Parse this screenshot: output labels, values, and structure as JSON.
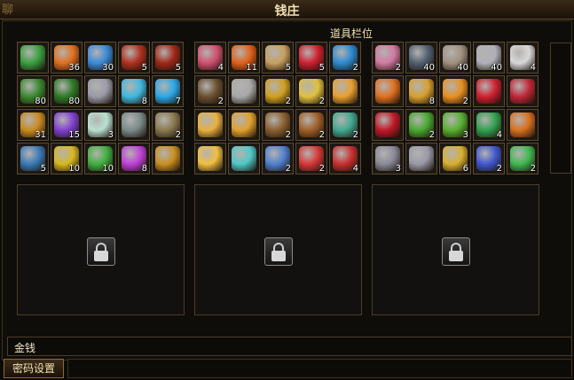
{
  "window": {
    "title": "钱庄",
    "title_deco": "聊"
  },
  "bag": {
    "label": "道具栏位"
  },
  "gold": {
    "label": "金钱"
  },
  "password_button": {
    "label": "密码设置"
  },
  "panels": [
    {
      "items": [
        {
          "icon": "green-leaf-icon",
          "color": "#3aa040",
          "count": ""
        },
        {
          "icon": "flame-icon",
          "color": "#e07020",
          "count": "36"
        },
        {
          "icon": "blue-crystal-icon",
          "color": "#3a8ad8",
          "count": "30"
        },
        {
          "icon": "red-beetle-icon",
          "color": "#b03020",
          "count": "5"
        },
        {
          "icon": "red-beetle-icon",
          "color": "#a02818",
          "count": "5"
        },
        {
          "icon": "green-leaf-icon",
          "color": "#3a8a30",
          "count": "80"
        },
        {
          "icon": "green-leaf-icon",
          "color": "#2e7a28",
          "count": "80"
        },
        {
          "icon": "silver-ore-icon",
          "color": "#9a9aa8",
          "count": ""
        },
        {
          "icon": "ice-spark-icon",
          "color": "#40b8e0",
          "count": "8"
        },
        {
          "icon": "ice-spark-icon",
          "color": "#2aa8e8",
          "count": "7"
        },
        {
          "icon": "gold-pouch-icon",
          "color": "#c88a20",
          "count": "31"
        },
        {
          "icon": "purple-orb-icon",
          "color": "#8040d0",
          "count": "15"
        },
        {
          "icon": "pale-jade-icon",
          "color": "#b8e0d0",
          "count": "3"
        },
        {
          "icon": "dagger-icon",
          "color": "#7a8a8a",
          "count": ""
        },
        {
          "icon": "brush-icon",
          "color": "#8a7a50",
          "count": "2"
        },
        {
          "icon": "blue-horn-icon",
          "color": "#3a7ab8",
          "count": "5"
        },
        {
          "icon": "gold-gem-icon",
          "color": "#d8b820",
          "count": "10"
        },
        {
          "icon": "green-crystal-icon",
          "color": "#40b040",
          "count": "10"
        },
        {
          "icon": "purple-gem-icon",
          "color": "#c040d8",
          "count": "8"
        },
        {
          "icon": "golden-staff-icon",
          "color": "#c89020",
          "count": ""
        }
      ]
    },
    {
      "items": [
        {
          "icon": "pink-scroll-icon",
          "color": "#d05070",
          "count": "4"
        },
        {
          "icon": "orange-wing-icon",
          "color": "#e06018",
          "count": "11"
        },
        {
          "icon": "book-icon",
          "color": "#c8a060",
          "count": "5"
        },
        {
          "icon": "red-seal-icon",
          "color": "#d02030",
          "count": "5"
        },
        {
          "icon": "earth-orb-icon",
          "color": "#2a8ad0",
          "count": "2"
        },
        {
          "icon": "chest-icon",
          "color": "#6a5030",
          "count": "2"
        },
        {
          "icon": "scroll-tile-icon",
          "color": "#a8a8a8",
          "count": ""
        },
        {
          "icon": "gold-feather-icon",
          "color": "#d0a020",
          "count": "2"
        },
        {
          "icon": "talisman-icon",
          "color": "#e0c040",
          "count": "2"
        },
        {
          "icon": "gold-nuggets-icon",
          "color": "#e8a030",
          "count": ""
        },
        {
          "icon": "lantern-icon",
          "color": "#e8b040",
          "count": ""
        },
        {
          "icon": "lantern-icon",
          "color": "#e0a030",
          "count": ""
        },
        {
          "icon": "shield-icon",
          "color": "#8a6030",
          "count": "2"
        },
        {
          "icon": "teapot-icon",
          "color": "#a06028",
          "count": "2"
        },
        {
          "icon": "jade-tree-icon",
          "color": "#40a890",
          "count": "2"
        },
        {
          "icon": "cloud-icon",
          "color": "#f0c040",
          "count": ""
        },
        {
          "icon": "spirit-orb-icon",
          "color": "#50c8c8",
          "count": ""
        },
        {
          "icon": "blue-beads-icon",
          "color": "#5080d0",
          "count": "2"
        },
        {
          "icon": "red-disc-icon",
          "color": "#d83838",
          "count": "2"
        },
        {
          "icon": "red-disc-icon",
          "color": "#c83030",
          "count": "4"
        }
      ]
    },
    {
      "items": [
        {
          "icon": "rainbow-orb-icon",
          "color": "#d07aa0",
          "count": "2"
        },
        {
          "icon": "dark-ore-icon",
          "color": "#506070",
          "count": "40"
        },
        {
          "icon": "light-ore-icon",
          "color": "#a09080",
          "count": "40"
        },
        {
          "icon": "silver-ore-icon",
          "color": "#b0b0b8",
          "count": "40"
        },
        {
          "icon": "white-tooth-icon",
          "color": "#d8d8d8",
          "count": "4"
        },
        {
          "icon": "orange-spiral-icon",
          "color": "#e07020",
          "count": ""
        },
        {
          "icon": "golden-tent-icon",
          "color": "#d8a030",
          "count": "8"
        },
        {
          "icon": "sun-medal-icon",
          "color": "#e89020",
          "count": "2"
        },
        {
          "icon": "red-jewel-icon",
          "color": "#d02030",
          "count": ""
        },
        {
          "icon": "red-ring-icon",
          "color": "#c02838",
          "count": ""
        },
        {
          "icon": "red-gear-icon",
          "color": "#c01828",
          "count": ""
        },
        {
          "icon": "green-gear-icon",
          "color": "#48a830",
          "count": "2"
        },
        {
          "icon": "green-gear-icon",
          "color": "#58b030",
          "count": "3"
        },
        {
          "icon": "jade-ring-icon",
          "color": "#30a050",
          "count": "4"
        },
        {
          "icon": "amber-gear-icon",
          "color": "#d87020",
          "count": ""
        },
        {
          "icon": "gray-diamond-icon",
          "color": "#8a8a98",
          "count": "3"
        },
        {
          "icon": "gray-diamond-icon",
          "color": "#9a9aa8",
          "count": ""
        },
        {
          "icon": "gold-ring-icon",
          "color": "#d8b030",
          "count": "6"
        },
        {
          "icon": "sapphire-icon",
          "color": "#4058d0",
          "count": "2"
        },
        {
          "icon": "emerald-icon",
          "color": "#40b850",
          "count": "2"
        }
      ]
    }
  ]
}
